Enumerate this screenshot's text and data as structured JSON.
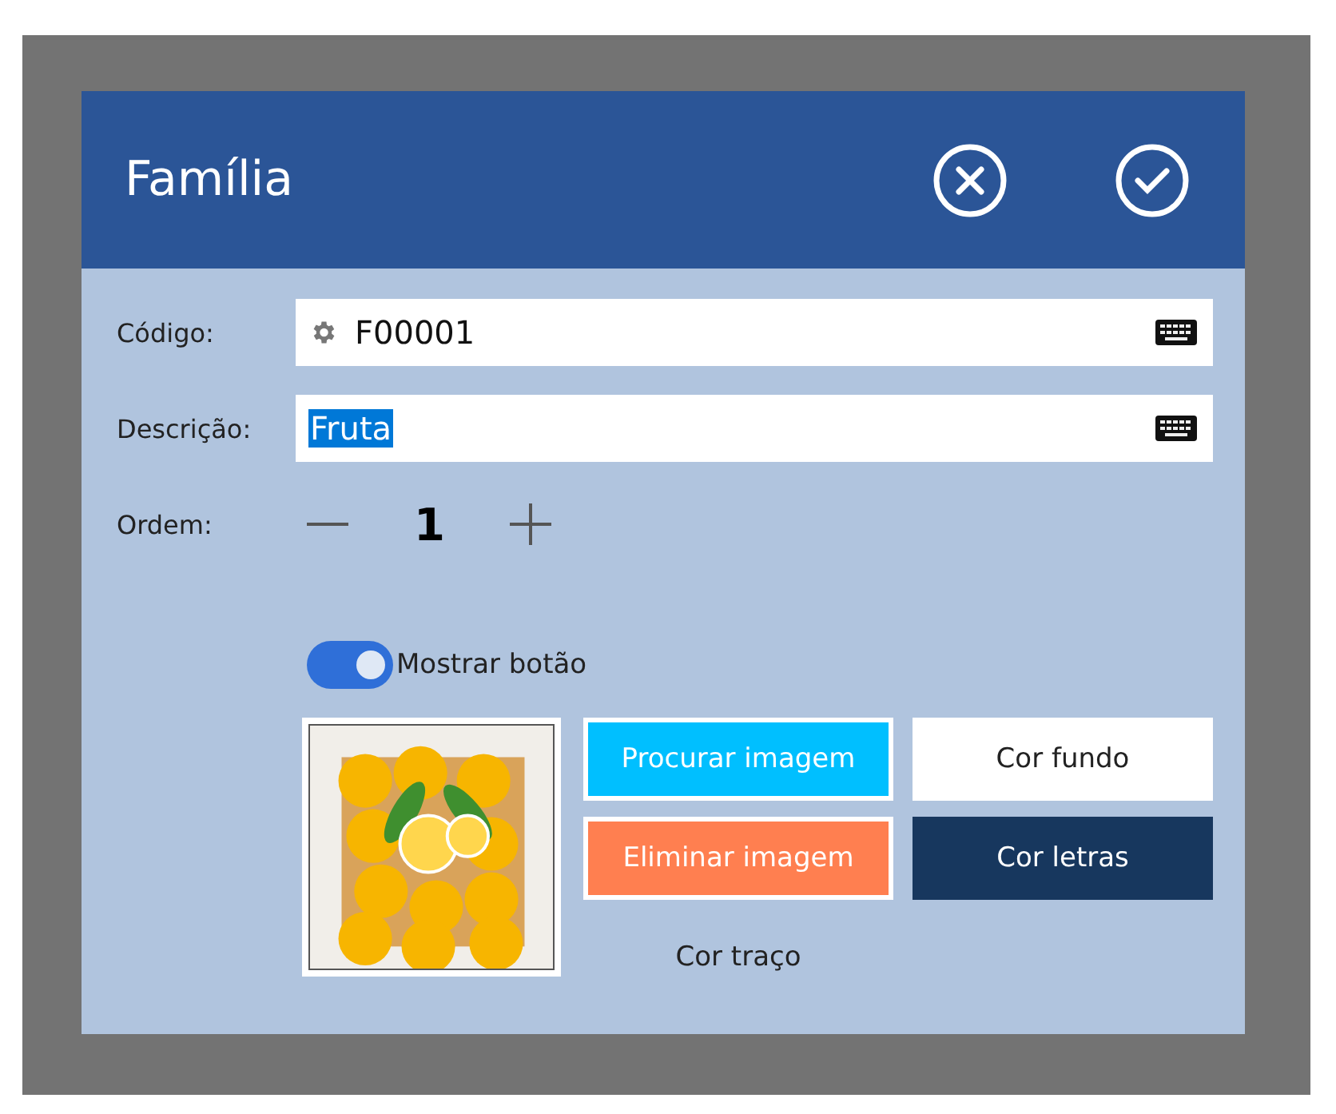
{
  "window": {
    "title": "Família",
    "actions": [
      {
        "kind": "cancel"
      },
      {
        "kind": "confirm"
      }
    ]
  },
  "fields": [
    {
      "label": "Código:",
      "value": "F00001",
      "gear": true,
      "selected": false
    },
    {
      "label": "Descrição:",
      "value": "Fruta",
      "gear": false,
      "selected": true
    }
  ],
  "order": {
    "label": "Ordem:",
    "value": "1"
  },
  "toggle": {
    "label": "Mostrar botão",
    "on": true
  },
  "buttons": [
    {
      "label": "Procurar imagem",
      "kind": "filled",
      "color": "#00bfff"
    },
    {
      "label": "Cor fundo",
      "kind": "filled",
      "color": "#ffffff"
    },
    {
      "label": "Eliminar imagem",
      "kind": "filled",
      "color": "#ff7f50"
    },
    {
      "label": "Cor letras",
      "kind": "filled",
      "color": "#17375e"
    },
    {
      "label": "Cor traço",
      "kind": "plain",
      "color": "#b0c4de"
    }
  ]
}
